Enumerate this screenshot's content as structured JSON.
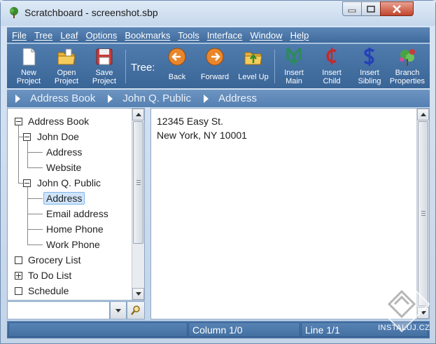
{
  "window": {
    "title": "Scratchboard - screenshot.sbp"
  },
  "menu": [
    "File",
    "Tree",
    "Leaf",
    "Options",
    "Bookmarks",
    "Tools",
    "Interface",
    "Window",
    "Help"
  ],
  "toolbar": {
    "new_project": [
      "New",
      "Project"
    ],
    "open_project": [
      "Open",
      "Project"
    ],
    "save_project": [
      "Save",
      "Project"
    ],
    "tree_label": "Tree:",
    "back": "Back",
    "forward": "Forward",
    "level_up": "Level Up",
    "insert_main": [
      "Insert",
      "Main"
    ],
    "insert_child": [
      "Insert",
      "Child"
    ],
    "insert_sibling": [
      "Insert",
      "Sibling"
    ],
    "branch_properties": [
      "Branch",
      "Properties"
    ]
  },
  "breadcrumb": [
    "Address Book",
    "John Q. Public",
    "Address"
  ],
  "tree": {
    "address_book": "Address Book",
    "john_doe": "John Doe",
    "jd_address": "Address",
    "jd_website": "Website",
    "john_q_public": "John Q. Public",
    "jqp_address": "Address",
    "jqp_email": "Email address",
    "jqp_home_phone": "Home Phone",
    "jqp_work_phone": "Work Phone",
    "grocery_list": "Grocery List",
    "to_do_list": "To Do List",
    "schedule": "Schedule"
  },
  "editor": {
    "line1": "12345 Easy St.",
    "line2": "New York, NY 10001"
  },
  "status": {
    "column": "Column 1/0",
    "line": "Line 1/1"
  },
  "watermark": "INSTALUJ.CZ",
  "colors": {
    "menubar": "#4a76a8",
    "toolbar": "#3f6a9c",
    "selection": "#cfe4fb"
  }
}
